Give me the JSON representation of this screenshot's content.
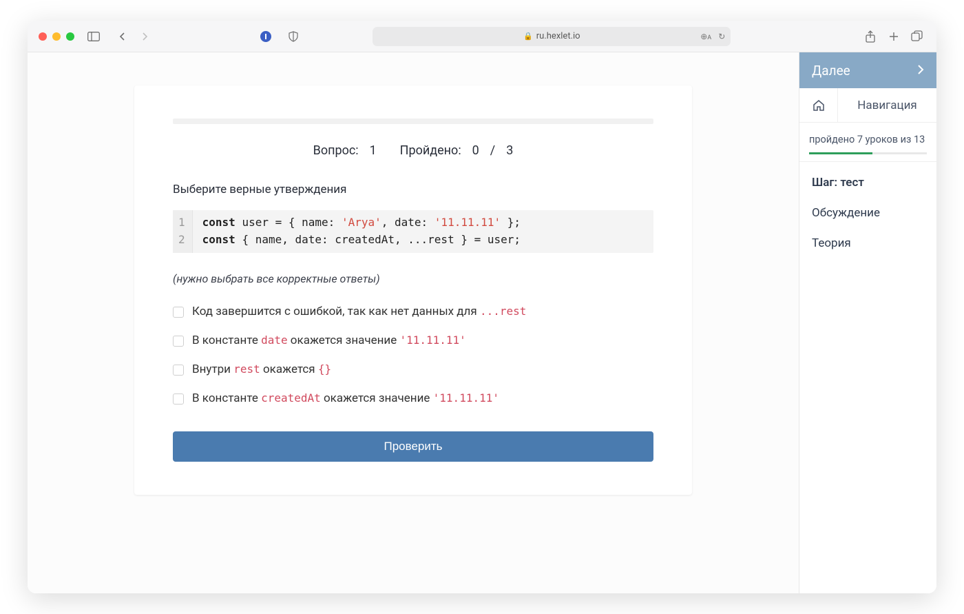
{
  "url": "ru.hexlet.io",
  "question": {
    "meta_question_label": "Вопрос:",
    "question_number": "1",
    "meta_passed_label": "Пройдено:",
    "passed": "0",
    "passed_sep": "/",
    "total": "3",
    "prompt": "Выберите верные утверждения",
    "hint": "(нужно выбрать все корректные ответы)",
    "code": {
      "lines": [
        "1",
        "2"
      ],
      "line1_kw": "const",
      "line1_mid": " user = { name: ",
      "line1_str1": "'Arya'",
      "line1_mid2": ", date: ",
      "line1_str2": "'11.11.11'",
      "line1_end": " };",
      "line2_kw": "const",
      "line2_rest": " { name, date: createdAt, ...rest } = user;"
    },
    "options": [
      {
        "pre": "Код завершится с ошибкой, так как нет данных для ",
        "code": "...rest",
        "post": ""
      },
      {
        "pre": "В константе ",
        "code": "date",
        "post": " окажется значение ",
        "code2": "'11.11.11'"
      },
      {
        "pre": "Внутри ",
        "code": "rest",
        "post": " окажется ",
        "code2": "{}"
      },
      {
        "pre": "В константе ",
        "code": "createdAt",
        "post": " окажется значение ",
        "code2": "'11.11.11'"
      }
    ],
    "submit": "Проверить"
  },
  "sidebar": {
    "next": "Далее",
    "nav": "Навигация",
    "progress_text": "пройдено 7 уроков из 13",
    "progress_done": 7,
    "progress_total": 13,
    "links": [
      {
        "label": "Шаг: тест",
        "active": true
      },
      {
        "label": "Обсуждение",
        "active": false
      },
      {
        "label": "Теория",
        "active": false
      }
    ]
  }
}
